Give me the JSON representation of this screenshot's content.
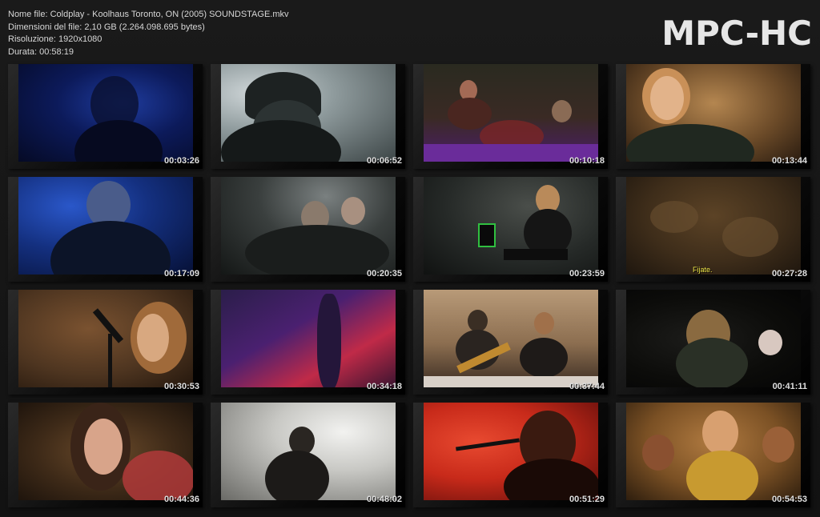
{
  "header": {
    "filename": "Nome file: Coldplay - Koolhaus Toronto, ON (2005) SOUNDSTAGE.mkv",
    "filesize": "Dimensioni del file: 2,10 GB (2.264.098.695 bytes)",
    "resolution": "Risoluzione: 1920x1080",
    "duration": "Durata: 00:58:19",
    "brand": "MPC-HC"
  },
  "thumbnails": [
    {
      "time": "00:03:26",
      "scene": "singer in blue light"
    },
    {
      "time": "00:06:52",
      "scene": "guitarist with cap in smoke"
    },
    {
      "time": "00:10:18",
      "scene": "drummer on stage with purple lights"
    },
    {
      "time": "00:13:44",
      "scene": "singer at microphone close-up"
    },
    {
      "time": "00:17:09",
      "scene": "singer in blue light"
    },
    {
      "time": "00:20:35",
      "scene": "crowd with hands raised"
    },
    {
      "time": "00:23:59",
      "scene": "singer at piano"
    },
    {
      "time": "00:27:28",
      "scene": "blurry crowd",
      "subtitle": "Fijate."
    },
    {
      "time": "00:30:53",
      "scene": "singer at microphone"
    },
    {
      "time": "00:34:18",
      "scene": "red and purple stage lights"
    },
    {
      "time": "00:37:44",
      "scene": "band playing guitars"
    },
    {
      "time": "00:41:11",
      "scene": "singer with crowd in dark"
    },
    {
      "time": "00:44:36",
      "scene": "smiling fan in crowd"
    },
    {
      "time": "00:48:02",
      "scene": "guitarist in white smoke"
    },
    {
      "time": "00:51:29",
      "scene": "singer in red light"
    },
    {
      "time": "00:54:53",
      "scene": "cheering crowd"
    }
  ]
}
